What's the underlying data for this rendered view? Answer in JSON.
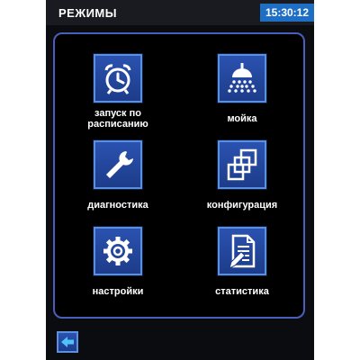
{
  "header": {
    "title": "РЕЖИМЫ",
    "time": "15:30:12"
  },
  "modes": [
    {
      "label": "запуск по расписанию",
      "icon": "alarm-clock-icon"
    },
    {
      "label": "мойка",
      "icon": "shower-icon"
    },
    {
      "label": "диагностика",
      "icon": "wrench-icon"
    },
    {
      "label": "конфигурация",
      "icon": "stacked-windows-icon"
    },
    {
      "label": "настройки",
      "icon": "gear-icon"
    },
    {
      "label": "статистика",
      "icon": "document-pen-icon"
    }
  ],
  "footer": {
    "back_icon": "arrow-left-icon"
  },
  "colors": {
    "device_bg": "#0b0c10",
    "panel_border": "#4a5fbb",
    "button_fill": "#2a52b0",
    "button_border": "#5b8fe0",
    "clock_bg": "#1e6fc4"
  }
}
